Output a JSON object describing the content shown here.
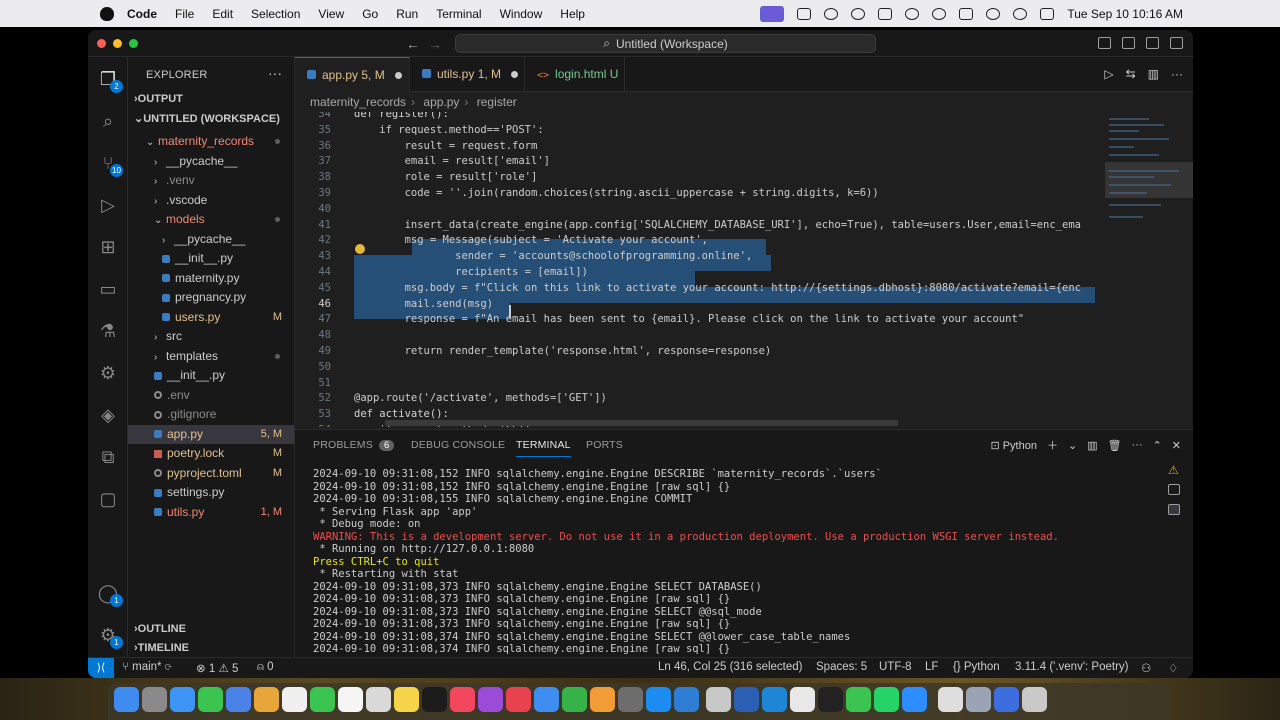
{
  "menubar": {
    "app_name": "Code",
    "items": [
      "File",
      "Edit",
      "Selection",
      "View",
      "Go",
      "Run",
      "Terminal",
      "Window",
      "Help"
    ],
    "clock": "Tue Sep 10  10:16 AM"
  },
  "window": {
    "search_text": "Untitled (Workspace)"
  },
  "activity": {
    "source_control_badge": "10",
    "extensions_badge": "2",
    "accounts_badge": "1",
    "manage_badge": "1"
  },
  "sidebar": {
    "title": "EXPLORER",
    "output_label": "OUTPUT",
    "workspace_label": "UNTITLED (WORKSPACE)",
    "timeline_label": "TIMELINE",
    "outline_label": "OUTLINE",
    "tree": [
      {
        "label": "maternity_records",
        "status": "",
        "dot": true
      },
      {
        "label": "__pycache__",
        "status": "",
        "dot": false
      },
      {
        "label": ".venv",
        "status": "",
        "dot": false
      },
      {
        "label": ".vscode",
        "status": "",
        "dot": false
      },
      {
        "label": "models",
        "status": "",
        "dot": true
      },
      {
        "label": "__pycache__",
        "status": "",
        "dot": false
      },
      {
        "label": "__init__.py",
        "status": "",
        "dot": false
      },
      {
        "label": "maternity.py",
        "status": "",
        "dot": false
      },
      {
        "label": "pregnancy.py",
        "status": "",
        "dot": false
      },
      {
        "label": "users.py",
        "status": "M",
        "dot": false
      },
      {
        "label": "src",
        "status": "",
        "dot": false
      },
      {
        "label": "templates",
        "status": "",
        "dot": true
      },
      {
        "label": "__init__.py",
        "status": "",
        "dot": false
      },
      {
        "label": ".env",
        "status": "",
        "dot": false
      },
      {
        "label": ".gitignore",
        "status": "",
        "dot": false
      },
      {
        "label": "app.py",
        "status": "5, M",
        "dot": false
      },
      {
        "label": "poetry.lock",
        "status": "M",
        "dot": false
      },
      {
        "label": "pyproject.toml",
        "status": "M",
        "dot": false
      },
      {
        "label": "settings.py",
        "status": "",
        "dot": false
      },
      {
        "label": "utils.py",
        "status": "1, M",
        "dot": false
      }
    ]
  },
  "tabs": [
    {
      "label": "app.py",
      "status": "5, M"
    },
    {
      "label": "utils.py",
      "status": "1, M"
    },
    {
      "label": "login.html",
      "status": "U"
    }
  ],
  "breadcrumb": [
    "maternity_records",
    "app.py",
    "register"
  ],
  "editor": {
    "lines": [
      {
        "n": "34",
        "text": "def register():"
      },
      {
        "n": "35",
        "text": "    if request.method=='POST':"
      },
      {
        "n": "36",
        "text": "        result = request.form"
      },
      {
        "n": "37",
        "text": "        email = result['email']"
      },
      {
        "n": "38",
        "text": "        role = result['role']"
      },
      {
        "n": "39",
        "text": "        code = ''.join(random.choices(string.ascii_uppercase + string.digits, k=6))"
      },
      {
        "n": "40",
        "text": ""
      },
      {
        "n": "41",
        "text": "        insert_data(create_engine(app.config['SQLALCHEMY_DATABASE_URI'], echo=True), table=users.User,email=enc_ema"
      },
      {
        "n": "42",
        "text": "        msg = Message(subject = 'Activate your account',"
      },
      {
        "n": "43",
        "text": "                sender = 'accounts@schoolofprogramming.online',"
      },
      {
        "n": "44",
        "text": "                recipients = [email])"
      },
      {
        "n": "45",
        "text": "        msg.body = f\"Click on this link to activate your account: http://{settings.dbhost}:8080/activate?email={enc"
      },
      {
        "n": "46",
        "text": "        mail.send(msg)"
      },
      {
        "n": "47",
        "text": "        response = f\"An email has been sent to {email}. Please click on the link to activate your account\""
      },
      {
        "n": "48",
        "text": ""
      },
      {
        "n": "49",
        "text": "        return render_template('response.html', response=response)"
      },
      {
        "n": "50",
        "text": ""
      },
      {
        "n": "51",
        "text": ""
      },
      {
        "n": "52",
        "text": "@app.route('/activate', methods=['GET'])"
      },
      {
        "n": "53",
        "text": "def activate():"
      },
      {
        "n": "54",
        "text": "    if request.method=='GET':"
      }
    ]
  },
  "panel": {
    "tabs": [
      {
        "label": "PROBLEMS",
        "count": "6"
      },
      {
        "label": "DEBUG CONSOLE",
        "count": ""
      },
      {
        "label": "TERMINAL",
        "count": ""
      },
      {
        "label": "PORTS",
        "count": ""
      }
    ],
    "terminal_profile": "Python",
    "terminal": [
      {
        "text": "2024-09-10 09:31:08,152 INFO sqlalchemy.engine.Engine DESCRIBE `maternity_records`.`users`",
        "kind": "normal"
      },
      {
        "text": "2024-09-10 09:31:08,152 INFO sqlalchemy.engine.Engine [raw sql] {}",
        "kind": "normal"
      },
      {
        "text": "2024-09-10 09:31:08,155 INFO sqlalchemy.engine.Engine COMMIT",
        "kind": "normal"
      },
      {
        "text": " * Serving Flask app 'app'",
        "kind": "normal"
      },
      {
        "text": " * Debug mode: on",
        "kind": "normal"
      },
      {
        "text": "WARNING: This is a development server. Do not use it in a production deployment. Use a production WSGI server instead.",
        "kind": "warn"
      },
      {
        "text": " * Running on http://127.0.0.1:8080",
        "kind": "normal"
      },
      {
        "text": "Press CTRL+C to quit",
        "kind": "yellow"
      },
      {
        "text": " * Restarting with stat",
        "kind": "normal"
      },
      {
        "text": "2024-09-10 09:31:08,373 INFO sqlalchemy.engine.Engine SELECT DATABASE()",
        "kind": "normal"
      },
      {
        "text": "2024-09-10 09:31:08,373 INFO sqlalchemy.engine.Engine [raw sql] {}",
        "kind": "normal"
      },
      {
        "text": "2024-09-10 09:31:08,373 INFO sqlalchemy.engine.Engine SELECT @@sql_mode",
        "kind": "normal"
      },
      {
        "text": "2024-09-10 09:31:08,373 INFO sqlalchemy.engine.Engine [raw sql] {}",
        "kind": "normal"
      },
      {
        "text": "2024-09-10 09:31:08,374 INFO sqlalchemy.engine.Engine SELECT @@lower_case_table_names",
        "kind": "normal"
      },
      {
        "text": "2024-09-10 09:31:08,374 INFO sqlalchemy.engine.Engine [raw sql] {}",
        "kind": "normal"
      }
    ]
  },
  "statusbar": {
    "branch": "main*",
    "errors": "1",
    "warnings": "5",
    "ports": "0",
    "position": "Ln 46, Col 25 (316 selected)",
    "spaces": "Spaces: 5",
    "encoding": "UTF-8",
    "eol": "LF",
    "language": "Python",
    "interpreter": "3.11.4 ('.venv': Poetry)"
  },
  "colors": {
    "accent": "#0078d4",
    "modified": "#e2c08d",
    "error": "#f48771",
    "selection": "#264f78"
  }
}
